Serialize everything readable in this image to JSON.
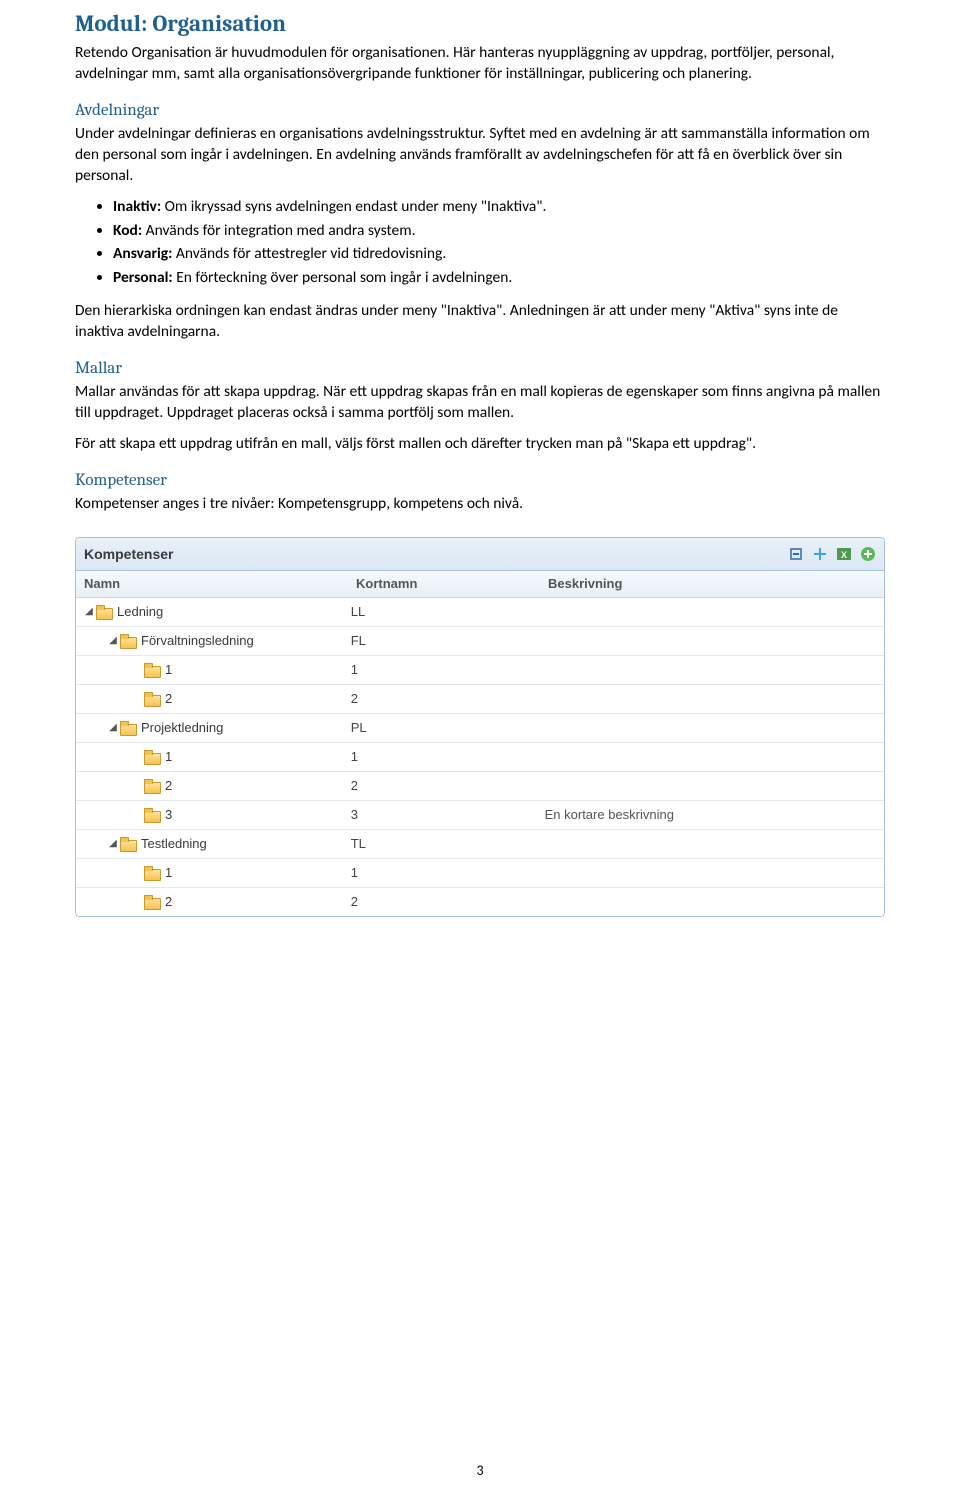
{
  "page_number": "3",
  "title": "Modul: Organisation",
  "intro": "Retendo Organisation är huvudmodulen för organisationen. Här hanteras nyuppläggning av uppdrag, portföljer, personal, avdelningar mm, samt alla organisationsövergripande funktioner för inställningar, publicering och planering.",
  "avdelningar": {
    "heading": "Avdelningar",
    "p1": "Under avdelningar definieras en organisations avdelningsstruktur. Syftet med en avdelning är att sammanställa information om den personal som ingår i avdelningen. En avdelning används framförallt av avdelningschefen för att få en överblick över sin personal.",
    "bullets": [
      {
        "label": "Inaktiv:",
        "text": " Om ikryssad syns avdelningen endast under meny \"Inaktiva\"."
      },
      {
        "label": "Kod:",
        "text": " Används för integration med andra system."
      },
      {
        "label": "Ansvarig:",
        "text": " Används för attestregler vid tidredovisning."
      },
      {
        "label": "Personal:",
        "text": " En förteckning över personal som ingår i avdelningen."
      }
    ],
    "p2": "Den hierarkiska ordningen kan endast ändras under meny \"Inaktiva\". Anledningen är att under meny \"Aktiva\" syns inte de inaktiva avdelningarna."
  },
  "mallar": {
    "heading": "Mallar",
    "p1": "Mallar användas för att skapa uppdrag. När ett uppdrag skapas från en mall kopieras de egenskaper som finns angivna på mallen till uppdraget. Uppdraget placeras också i samma portfölj som mallen.",
    "p2": "För att skapa ett uppdrag utifrån en mall, väljs först mallen och därefter trycken man på \"Skapa ett uppdrag\"."
  },
  "kompetenser": {
    "heading": "Kompetenser",
    "intro": "Kompetenser anges i tre nivåer: Kompetensgrupp, kompetens och nivå.",
    "panel_title": "Kompetenser",
    "columns": {
      "c1": "Namn",
      "c2": "Kortnamn",
      "c3": "Beskrivning"
    },
    "rows": [
      {
        "depth": 0,
        "expander": "◢",
        "name": "Ledning",
        "kort": "LL",
        "besk": ""
      },
      {
        "depth": 1,
        "expander": "◢",
        "name": "Förvaltningsledning",
        "kort": "FL",
        "besk": ""
      },
      {
        "depth": 2,
        "expander": "",
        "name": "1",
        "kort": "1",
        "besk": ""
      },
      {
        "depth": 2,
        "expander": "",
        "name": "2",
        "kort": "2",
        "besk": ""
      },
      {
        "depth": 1,
        "expander": "◢",
        "name": "Projektledning",
        "kort": "PL",
        "besk": ""
      },
      {
        "depth": 2,
        "expander": "",
        "name": "1",
        "kort": "1",
        "besk": ""
      },
      {
        "depth": 2,
        "expander": "",
        "name": "2",
        "kort": "2",
        "besk": ""
      },
      {
        "depth": 2,
        "expander": "",
        "name": "3",
        "kort": "3",
        "besk": "En kortare beskrivning"
      },
      {
        "depth": 1,
        "expander": "◢",
        "name": "Testledning",
        "kort": "TL",
        "besk": ""
      },
      {
        "depth": 2,
        "expander": "",
        "name": "1",
        "kort": "1",
        "besk": ""
      },
      {
        "depth": 2,
        "expander": "",
        "name": "2",
        "kort": "2",
        "besk": ""
      }
    ]
  }
}
